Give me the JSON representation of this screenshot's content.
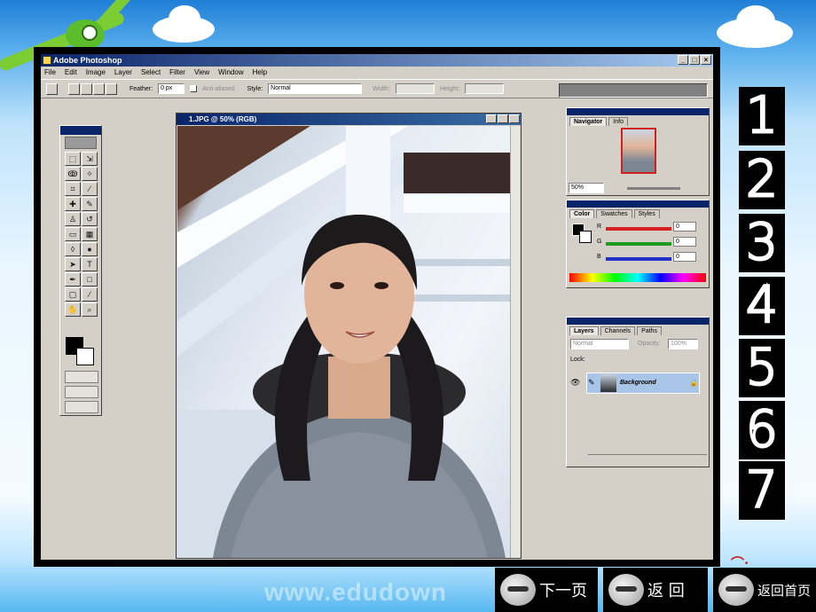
{
  "app": {
    "title": "Adobe Photoshop"
  },
  "menu": [
    "File",
    "Edit",
    "Image",
    "Layer",
    "Select",
    "Filter",
    "View",
    "Window",
    "Help"
  ],
  "window_buttons": {
    "minimize": "_",
    "maximize": "□",
    "close": "×"
  },
  "options_bar": {
    "feather_label": "Feather:",
    "feather_value": "0 px",
    "anti_aliased_label": "Anti-aliased",
    "style_label": "Style:",
    "style_value": "Normal",
    "width_label": "Width:",
    "height_label": "Height:"
  },
  "document": {
    "title": "1.JPG @ 50% (RGB)"
  },
  "navigator": {
    "tabs": [
      "Navigator",
      "Info"
    ],
    "zoom": "50%"
  },
  "color_panel": {
    "tabs": [
      "Color",
      "Swatches",
      "Styles"
    ],
    "channels": [
      {
        "label": "R",
        "value": "0",
        "color": "#d42020"
      },
      {
        "label": "G",
        "value": "0",
        "color": "#1e9a1e"
      },
      {
        "label": "B",
        "value": "0",
        "color": "#2030c8"
      }
    ]
  },
  "layers_panel": {
    "tabs": [
      "Layers",
      "Channels",
      "Paths"
    ],
    "blend_mode": "Normal",
    "opacity_label": "Opacity:",
    "opacity_value": "100%",
    "lock_label": "Lock:",
    "layer_name": "Background"
  },
  "steps": [
    "1",
    "2",
    "3",
    "4",
    "5",
    "6",
    "7"
  ],
  "nav_buttons": [
    {
      "label": "下一页"
    },
    {
      "label": "返 回"
    },
    {
      "label": "返回首页"
    }
  ],
  "watermark": "www.edudown",
  "colors": {
    "title_bar": "#0a246a",
    "window_bg": "#d4d0c8",
    "accent_red": "#c8201e"
  }
}
